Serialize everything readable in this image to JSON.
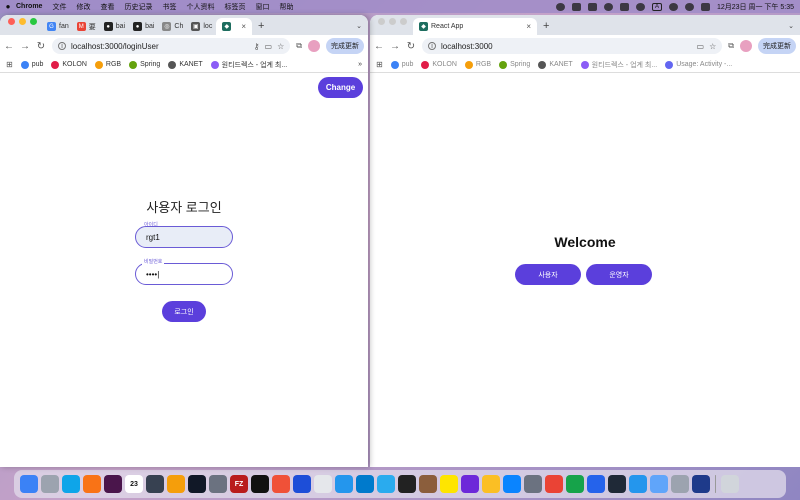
{
  "menubar": {
    "apple": "",
    "items": [
      "Chrome",
      "文件",
      "修改",
      "查看",
      "历史记录",
      "书签",
      "个人资料",
      "标签页",
      "窗口",
      "帮助"
    ],
    "clock": "12月23日 周一 下午 5:35",
    "input_badge": "A"
  },
  "left_window": {
    "tabs": [
      {
        "label": "fan",
        "color": "#4285f4",
        "glyph": "G"
      },
      {
        "label": "要",
        "color": "#ea4335",
        "glyph": "M"
      },
      {
        "label": "bai",
        "color": "#222222",
        "glyph": "●"
      },
      {
        "label": "bai",
        "color": "#222222",
        "glyph": "●"
      },
      {
        "label": "Ch",
        "color": "#888888",
        "glyph": "◎"
      },
      {
        "label": "loc",
        "color": "#555555",
        "glyph": "▣"
      },
      {
        "label": "",
        "color": "#1d6d5f",
        "glyph": "◆"
      }
    ],
    "url": "localhost:3000/loginUser",
    "update_label": "完成更新",
    "bookmarks": [
      {
        "label": "pub",
        "color": "#3b82f6"
      },
      {
        "label": "KOLON",
        "color": "#e11d48"
      },
      {
        "label": "RGB",
        "color": "#f59e0b"
      },
      {
        "label": "Spring",
        "color": "#65a30d"
      },
      {
        "label": "KANET",
        "color": "#555555"
      },
      {
        "label": "원티드렉스 - 업계 최...",
        "color": "#8b5cf6"
      }
    ],
    "bookmarks_more": "»",
    "page": {
      "change_label": "Change",
      "title": "사용자 로그인",
      "id_label": "아이디",
      "id_value": "rgt1",
      "pw_label": "비밀번호",
      "pw_value": "••••|",
      "login_label": "로그인"
    }
  },
  "right_window": {
    "tab_title": "React App",
    "url": "localhost:3000",
    "update_label": "完成更新",
    "bookmarks": [
      {
        "label": "pub",
        "color": "#3b82f6"
      },
      {
        "label": "KOLON",
        "color": "#e11d48"
      },
      {
        "label": "RGB",
        "color": "#f59e0b"
      },
      {
        "label": "Spring",
        "color": "#65a30d"
      },
      {
        "label": "KANET",
        "color": "#555555"
      },
      {
        "label": "원티드렉스 - 업계 최...",
        "color": "#8b5cf6"
      },
      {
        "label": "Usage: Activity -...",
        "color": "#6366f1"
      }
    ],
    "page": {
      "welcome": "Welcome",
      "user_btn": "사용자",
      "admin_btn": "운영자"
    }
  },
  "dock": {
    "calendar_day": "23",
    "apps": [
      {
        "name": "finder",
        "color": "#3b82f6",
        "glyph": ""
      },
      {
        "name": "launchpad",
        "color": "#9ca3af",
        "glyph": ""
      },
      {
        "name": "safari",
        "color": "#0ea5e9",
        "glyph": ""
      },
      {
        "name": "photos",
        "color": "#f97316",
        "glyph": ""
      },
      {
        "name": "slack",
        "color": "#4a154b",
        "glyph": ""
      },
      {
        "name": "calendar",
        "color": "#ffffff",
        "glyph": "23"
      },
      {
        "name": "calculator",
        "color": "#374151",
        "glyph": ""
      },
      {
        "name": "notes",
        "color": "#f59e0b",
        "glyph": ""
      },
      {
        "name": "terminal",
        "color": "#111827",
        "glyph": ""
      },
      {
        "name": "screen",
        "color": "#6b7280",
        "glyph": ""
      },
      {
        "name": "filezilla",
        "color": "#b91c1c",
        "glyph": "FZ"
      },
      {
        "name": "iterm",
        "color": "#111111",
        "glyph": ""
      },
      {
        "name": "swift",
        "color": "#f05138",
        "glyph": ""
      },
      {
        "name": "xcode",
        "color": "#1d4ed8",
        "glyph": ""
      },
      {
        "name": "pages",
        "color": "#e5e7eb",
        "glyph": ""
      },
      {
        "name": "docker",
        "color": "#2496ed",
        "glyph": ""
      },
      {
        "name": "vscode",
        "color": "#007acc",
        "glyph": ""
      },
      {
        "name": "telegram",
        "color": "#2aabee",
        "glyph": ""
      },
      {
        "name": "unity",
        "color": "#222222",
        "glyph": ""
      },
      {
        "name": "archive",
        "color": "#8b5e3c",
        "glyph": ""
      },
      {
        "name": "kakaotalk",
        "color": "#fee500",
        "glyph": ""
      },
      {
        "name": "shortcuts",
        "color": "#6d28d9",
        "glyph": ""
      },
      {
        "name": "notes-yellow",
        "color": "#fbbf24",
        "glyph": ""
      },
      {
        "name": "app-store",
        "color": "#0a84ff",
        "glyph": ""
      },
      {
        "name": "settings",
        "color": "#6b7280",
        "glyph": ""
      },
      {
        "name": "chrome",
        "color": "#ea4335",
        "glyph": ""
      },
      {
        "name": "numbers",
        "color": "#16a34a",
        "glyph": ""
      },
      {
        "name": "keynote",
        "color": "#2563eb",
        "glyph": ""
      },
      {
        "name": "activity",
        "color": "#1f2937",
        "glyph": ""
      },
      {
        "name": "docker-2",
        "color": "#2496ed",
        "glyph": ""
      },
      {
        "name": "preview",
        "color": "#60a5fa",
        "glyph": ""
      },
      {
        "name": "migration",
        "color": "#9ca3af",
        "glyph": ""
      },
      {
        "name": "quicktime",
        "color": "#1e3a8a",
        "glyph": ""
      },
      {
        "name": "trash",
        "color": "#d1d5db",
        "glyph": ""
      }
    ]
  }
}
